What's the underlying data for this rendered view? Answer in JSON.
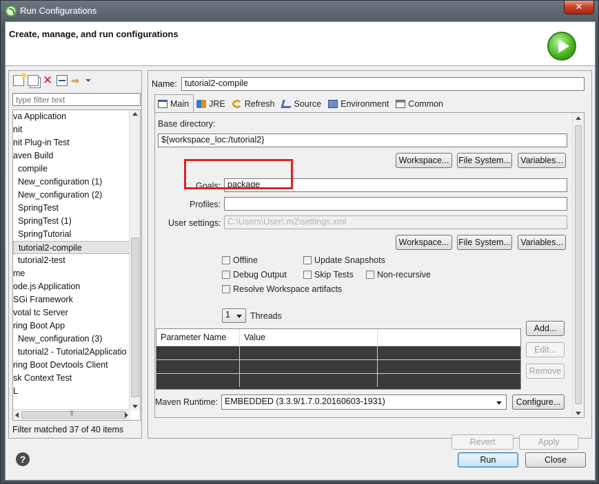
{
  "window": {
    "title": "Run Configurations",
    "close_label": "✕"
  },
  "header": {
    "title": "Create, manage, and run configurations"
  },
  "left": {
    "filter_placeholder": "type filter text",
    "tree_items": [
      "va Application",
      "nit",
      "nit Plug-in Test",
      "aven Build",
      "  compile",
      "  New_configuration (1)",
      "  New_configuration (2)",
      "  SpringTest",
      "  SpringTest (1)",
      "  SpringTutorial",
      "  tutorial2-compile",
      "  tutorial2-test",
      "me",
      "ode.js Application",
      "SGi Framework",
      "votal tc Server",
      "ring Boot App",
      "  New_configuration (3)",
      "  tutorial2 - Tutorial2Applicatio",
      "ring Boot Devtools Client",
      "sk Context Test",
      "L"
    ],
    "selected_index": 10,
    "filter_matched": "Filter matched 37 of 40 items"
  },
  "config": {
    "name_label": "Name:",
    "name_value": "tutorial2-compile",
    "tabs": [
      "Main",
      "JRE",
      "Refresh",
      "Source",
      "Environment",
      "Common"
    ],
    "base_dir_label": "Base directory:",
    "base_dir_value": "${workspace_loc:/tutorial2}",
    "workspace_btn": "Workspace...",
    "filesystem_btn": "File System...",
    "variables_btn": "Variables...",
    "goals_label": "Goals:",
    "goals_value": "package",
    "profiles_label": "Profiles:",
    "profiles_value": "",
    "user_settings_label": "User settings:",
    "user_settings_value": "C:\\Users\\User\\.m2\\settings.xml",
    "options": {
      "offline": "Offline",
      "update_snapshots": "Update Snapshots",
      "debug_output": "Debug Output",
      "skip_tests": "Skip Tests",
      "non_recursive": "Non-recursive",
      "resolve_workspace": "Resolve Workspace artifacts"
    },
    "threads_value": "1",
    "threads_label": "Threads",
    "table_headers": [
      "Parameter Name",
      "Value"
    ],
    "add_btn": "Add...",
    "edit_btn": "Edit...",
    "remove_btn": "Remove",
    "runtime_label": "Maven Runtime:",
    "runtime_value": "EMBEDDED (3.3.9/1.7.0.20160603-1931)",
    "configure_btn": "Configure..."
  },
  "footer": {
    "revert_btn": "Revert",
    "apply_btn": "Apply",
    "run_btn": "Run",
    "close_btn": "Close",
    "help_glyph": "?"
  }
}
